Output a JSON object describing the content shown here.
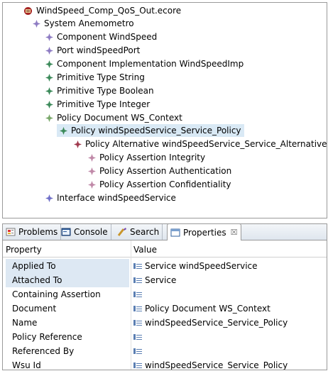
{
  "tree": {
    "items": [
      {
        "label": "WindSpeed_Comp_QoS_Out.ecore",
        "icon": "ecore-resource-icon",
        "color": "#a52222"
      },
      {
        "label": "System Anemometro",
        "icon": "diamond-icon",
        "color": "#8e7cc3"
      },
      {
        "label": "Component WindSpeed",
        "icon": "diamond-icon",
        "color": "#8e7cc3"
      },
      {
        "label": "Port windSpeedPort",
        "icon": "diamond-icon",
        "color": "#8e7cc3"
      },
      {
        "label": "Component Implementation WindSpeedImp",
        "icon": "diamond-icon",
        "color": "#3c8a5a"
      },
      {
        "label": "Primitive Type String",
        "icon": "diamond-icon",
        "color": "#3c8a5a"
      },
      {
        "label": "Primitive Type Boolean",
        "icon": "diamond-icon",
        "color": "#3c8a5a"
      },
      {
        "label": "Primitive Type Integer",
        "icon": "diamond-icon",
        "color": "#3c8a5a"
      },
      {
        "label": "Policy Document WS_Context",
        "icon": "diamond-icon",
        "color": "#7aa86a"
      },
      {
        "label": "Policy windSpeedService_Service_Policy",
        "icon": "diamond-icon",
        "color": "#3c8a5a"
      },
      {
        "label": "Policy Alternative windSpeedService_Service_Alternative",
        "icon": "diamond-icon",
        "color": "#a03a4e"
      },
      {
        "label": "Policy Assertion Integrity",
        "icon": "diamond-icon",
        "color": "#c089a8"
      },
      {
        "label": "Policy Assertion Authentication",
        "icon": "diamond-icon",
        "color": "#c089a8"
      },
      {
        "label": "Policy Assertion Confidentiality",
        "icon": "diamond-icon",
        "color": "#c089a8"
      },
      {
        "label": "Interface windSpeedService",
        "icon": "diamond-icon",
        "color": "#6f6fc8"
      }
    ]
  },
  "tabs": [
    {
      "label": "Problems",
      "icon": "problems-icon"
    },
    {
      "label": "Console",
      "icon": "console-icon"
    },
    {
      "label": "Search",
      "icon": "search-icon"
    },
    {
      "label": "Properties",
      "icon": "properties-icon",
      "active": true,
      "close": "☒"
    }
  ],
  "properties": {
    "header": {
      "property": "Property",
      "value": "Value"
    },
    "rows": [
      {
        "key": "Applied To",
        "value": "Service windSpeedService"
      },
      {
        "key": "Attached To",
        "value": "Service"
      },
      {
        "key": "Containing Assertion",
        "value": ""
      },
      {
        "key": "Document",
        "value": "Policy Document WS_Context"
      },
      {
        "key": "Name",
        "value": "windSpeedService_Service_Policy"
      },
      {
        "key": "Policy Reference",
        "value": ""
      },
      {
        "key": "Referenced By",
        "value": ""
      },
      {
        "key": "Wsu Id",
        "value": "windSpeedService_Service_Policy"
      }
    ]
  },
  "colors": {
    "selection": "#d9e9f5",
    "key_shade": "#dde8f3",
    "border": "#9a9a9a"
  }
}
